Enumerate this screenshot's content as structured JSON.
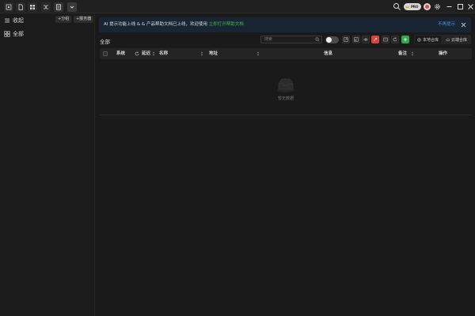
{
  "titlebar": {
    "tabs": [
      {
        "icon": "home-icon"
      },
      {
        "icon": "file-icon"
      },
      {
        "icon": "grid-icon"
      },
      {
        "icon": "shuffle-icon"
      },
      {
        "icon": "list-icon",
        "active": true
      },
      {
        "icon": "chevron-down-icon"
      }
    ],
    "pro_badge": "PRO",
    "controls": [
      "search-icon",
      "settings-icon",
      "minimize-icon",
      "maximize-icon",
      "close-icon"
    ]
  },
  "sidebar": {
    "section_label": "收起",
    "buttons": [
      "+分组",
      "+服务器"
    ],
    "items": [
      {
        "label": "全部",
        "icon": "grid-icon"
      }
    ]
  },
  "notice": {
    "message": "AI 提示功能上线 & & 产品帮助文档已上线，欢迎使用",
    "link": "立即打开帮助文档",
    "dismiss": "不再提示"
  },
  "toolbar": {
    "breadcrumb": "全部",
    "search_placeholder": "搜索",
    "seg_local": "本地合库",
    "seg_cloud": "云端合库"
  },
  "table": {
    "headers": {
      "system": "系统",
      "delay": "延迟",
      "name": "名称",
      "address": "地址",
      "info": "信息",
      "remark": "备注",
      "action": "操作"
    },
    "empty_text": "暂无数据",
    "rows": []
  },
  "colors": {
    "accent_green": "#3fb950",
    "accent_blue": "#4a8fe0",
    "danger_red": "#d9453a",
    "background": "#1a1a1a"
  }
}
